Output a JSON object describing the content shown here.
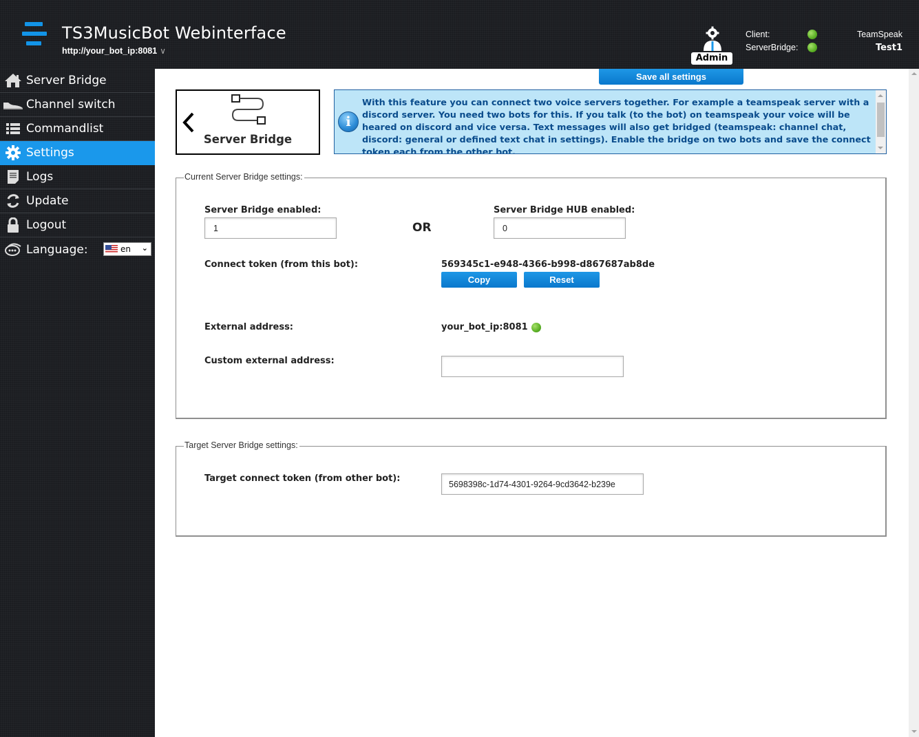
{
  "header": {
    "app_title": "TS3MusicBot Webinterface",
    "bot_url": "http://your_bot_ip:8081",
    "user_role": "Admin",
    "status": [
      {
        "label": "Client:",
        "state": "online",
        "color": "#5bb025"
      },
      {
        "label": "ServerBridge:",
        "state": "online",
        "color": "#5bb025"
      }
    ],
    "platform": "TeamSpeak",
    "server_name": "Test1"
  },
  "sidebar": {
    "items": [
      {
        "label": "Server Bridge",
        "icon": "home-icon",
        "active": false
      },
      {
        "label": "Channel switch",
        "icon": "sneaker-icon",
        "active": false
      },
      {
        "label": "Commandlist",
        "icon": "list-icon",
        "active": false
      },
      {
        "label": "Settings",
        "icon": "gear-icon",
        "active": true
      },
      {
        "label": "Logs",
        "icon": "document-icon",
        "active": false
      },
      {
        "label": "Update",
        "icon": "refresh-icon",
        "active": false
      },
      {
        "label": "Logout",
        "icon": "lock-icon",
        "active": false
      }
    ],
    "language_label": "Language:",
    "language_value": "en"
  },
  "toolbar": {
    "save_all_label": "Save all settings"
  },
  "page": {
    "title": "Server Bridge",
    "info_text": "With this feature you can connect two voice servers together. For example a teamspeak server with a discord server. You need two bots for this. If you talk (to the bot) on teamspeak your voice will be heared on discord and vice versa. Text messages will also get bridged (teamspeak: channel chat, discord: general or defined text chat in settings). Enable the bridge on two bots and save the connect token each from the other bot."
  },
  "current_settings": {
    "legend": "Current Server Bridge settings:",
    "bridge_enabled_label": "Server Bridge enabled:",
    "bridge_enabled_value": "1",
    "or_label": "OR",
    "hub_enabled_label": "Server Bridge HUB enabled:",
    "hub_enabled_value": "0",
    "connect_token_label": "Connect token (from this bot):",
    "connect_token_value": "569345c1-e948-4366-b998-d867687ab8de",
    "copy_label": "Copy",
    "reset_label": "Reset",
    "external_address_label": "External address:",
    "external_address_value": "your_bot_ip:8081",
    "external_address_status": "online",
    "custom_external_address_label": "Custom external address:",
    "custom_external_address_value": ""
  },
  "target_settings": {
    "legend": "Target Server Bridge settings:",
    "target_token_label": "Target connect token (from other bot):",
    "target_token_value": "5698398c-1d74-4301-9264-9cd3642-b239e"
  },
  "colors": {
    "accent": "#1a98eb",
    "info_bg": "#bde5f8",
    "info_text": "#0a4c8c",
    "status_green": "#5bb025"
  }
}
